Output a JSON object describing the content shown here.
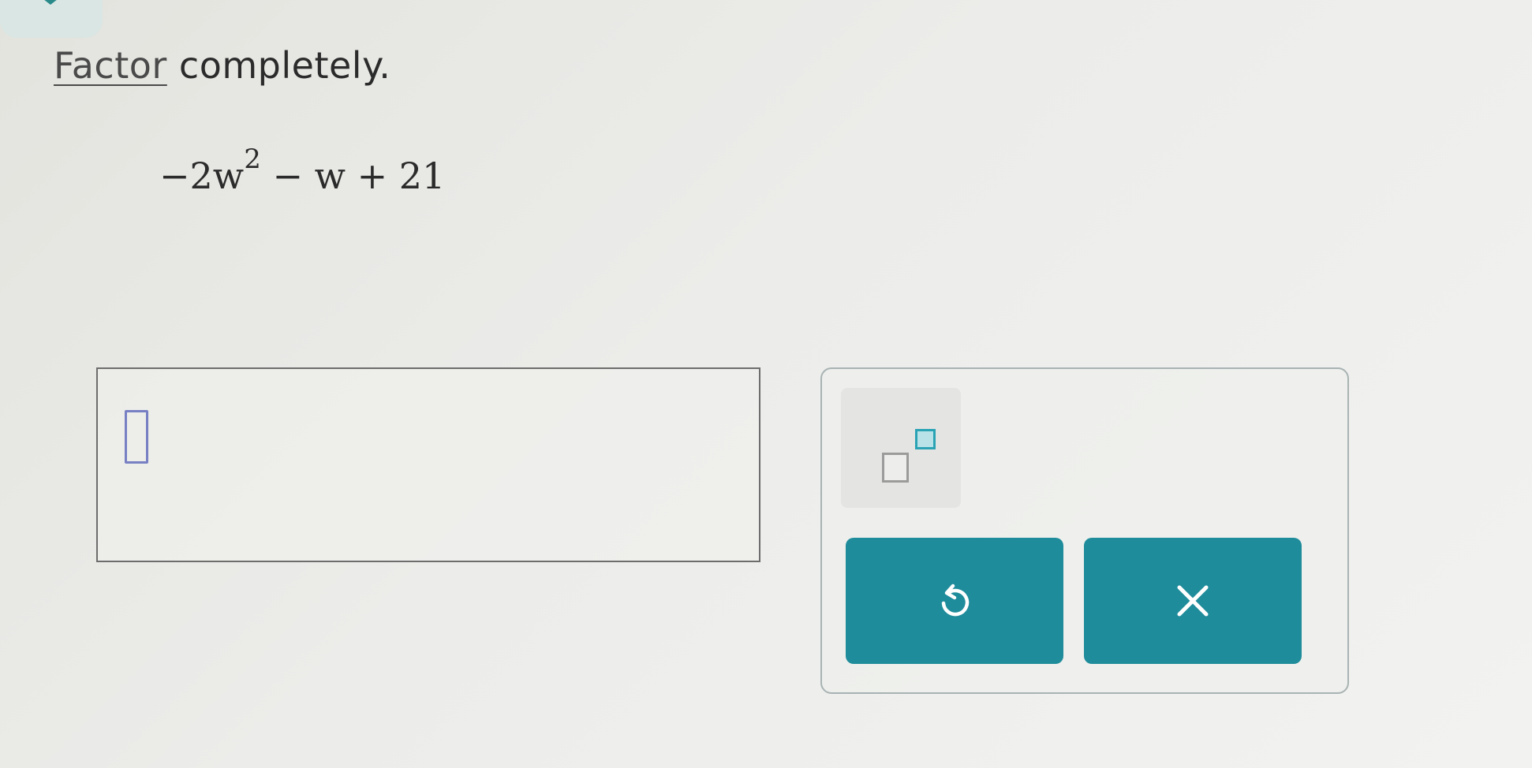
{
  "question": {
    "instruction_link": "Factor",
    "instruction_rest": " completely.",
    "expression": {
      "part1": "−2w",
      "exponent": "2",
      "part2": " − w + 21"
    }
  },
  "answer": {
    "value": ""
  },
  "keypad": {
    "exponent_key": "superscript-template",
    "undo": "undo-icon",
    "clear": "close-icon"
  },
  "colors": {
    "accent": "#1f8c9b",
    "cursor": "#7880c4",
    "exponent_highlight": "#2aa3b5"
  }
}
